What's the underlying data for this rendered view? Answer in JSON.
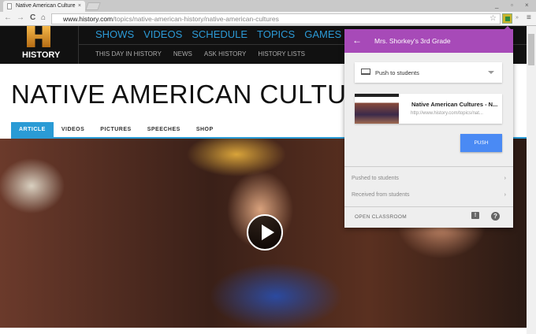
{
  "browser": {
    "tab_title": "Native American Culture",
    "close": "×",
    "url_domain": "www.history.com",
    "url_path": "/topics/native-american-history/native-american-cultures",
    "minimize": "_",
    "restore": "▫",
    "close_window": "×",
    "back": "←",
    "forward": "→",
    "reload": "C",
    "home": "⌂",
    "star": "☆",
    "menu": "≡",
    "more": "»"
  },
  "site": {
    "logo_text": "HISTORY",
    "main_nav": [
      "SHOWS",
      "VIDEOS",
      "SCHEDULE",
      "TOPICS",
      "GAMES"
    ],
    "sub_nav": [
      "THIS DAY IN HISTORY",
      "NEWS",
      "ASK HISTORY",
      "HISTORY LISTS"
    ],
    "page_title": "NATIVE AMERICAN CULTURES",
    "content_tabs": [
      "ARTICLE",
      "VIDEOS",
      "PICTURES",
      "SPEECHES",
      "SHOP"
    ]
  },
  "popup": {
    "back": "←",
    "class_name": "Mrs. Shorkey's 3rd Grade",
    "mode": "Push to students",
    "card_title": "Native American Cultures - N...",
    "card_url": "http://www.history.com/topics/nat...",
    "push_label": "PUSH",
    "links": [
      "Pushed to students",
      "Received from students"
    ],
    "chevron": "›",
    "open_classroom": "OPEN CLASSROOM",
    "feedback": "!",
    "help": "?"
  },
  "colors": {
    "accent": "#a74ab8",
    "push": "#4a8af4",
    "site_link": "#2c9ad6"
  }
}
